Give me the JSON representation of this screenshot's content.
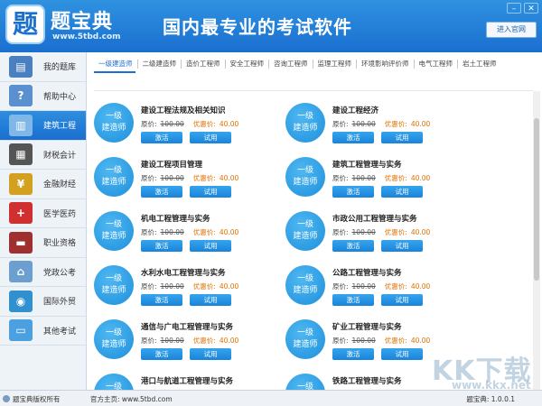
{
  "header": {
    "logo_char": "题",
    "app_name": "题宝典",
    "url": "www.5tbd.com",
    "slogan": "国内最专业的考试软件",
    "enter_site": "进入官网",
    "accent": "#1a6fcf"
  },
  "sidebar": {
    "items": [
      {
        "label": "我的题库",
        "icon": "book-stack-icon"
      },
      {
        "label": "帮助中心",
        "icon": "help-icon"
      },
      {
        "label": "建筑工程",
        "icon": "building-icon"
      },
      {
        "label": "财税会计",
        "icon": "calculator-icon"
      },
      {
        "label": "金融财经",
        "icon": "money-bag-icon"
      },
      {
        "label": "医学医药",
        "icon": "medical-kit-icon"
      },
      {
        "label": "职业资格",
        "icon": "certificate-books-icon"
      },
      {
        "label": "党政公考",
        "icon": "government-building-icon"
      },
      {
        "label": "国际外贸",
        "icon": "globe-icon"
      },
      {
        "label": "其他考试",
        "icon": "folder-icon"
      }
    ],
    "active_index": 2
  },
  "tabs": [
    "一级建造师",
    "二级建造师",
    "造价工程师",
    "安全工程师",
    "咨询工程师",
    "监理工程师",
    "环境影响评价师",
    "电气工程师",
    "岩土工程师"
  ],
  "courses": {
    "badge_line1": "一级",
    "badge_line2": "建造师",
    "orig_label": "原价:",
    "orig_price": "100.00",
    "disc_label": "优惠价:",
    "disc_price": "40.00",
    "activate_label": "激活",
    "trial_label": "试用",
    "items": [
      "建设工程法规及相关知识",
      "建设工程经济",
      "建设工程项目管理",
      "建筑工程管理与实务",
      "机电工程管理与实务",
      "市政公用工程管理与实务",
      "水利水电工程管理与实务",
      "公路工程管理与实务",
      "通信与广电工程管理与实务",
      "矿业工程管理与实务",
      "港口与航道工程管理与实务",
      "铁路工程管理与实务"
    ]
  },
  "footer": {
    "copyright": "题宝典版权所有",
    "home": "官方主页: www.5tbd.com",
    "version": "题宝典: 1.0.0.1"
  },
  "watermark": {
    "text": "KK下载",
    "url": "www.kkx.net"
  }
}
